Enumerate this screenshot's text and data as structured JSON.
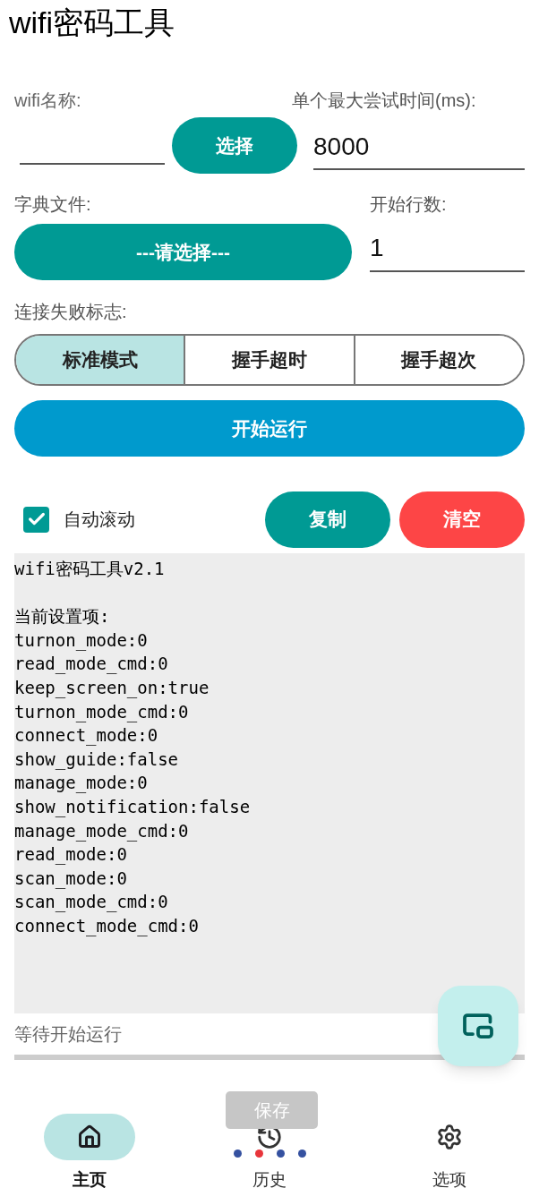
{
  "title": "wifi密码工具",
  "wifi_name": {
    "label": "wifi名称:",
    "button": "选择"
  },
  "max_time": {
    "label": "单个最大尝试时间(ms):",
    "value": "8000"
  },
  "dict_file": {
    "label": "字典文件:",
    "button": "---请选择---"
  },
  "start_line": {
    "label": "开始行数:",
    "value": "1"
  },
  "fail_flag": {
    "label": "连接失败标志:",
    "options": [
      {
        "label": "标准模式",
        "selected": true
      },
      {
        "label": "握手超时",
        "selected": false
      },
      {
        "label": "握手超次",
        "selected": false
      }
    ]
  },
  "run_button": "开始运行",
  "auto_scroll": {
    "label": "自动滚动",
    "checked": true
  },
  "copy_button": "复制",
  "clear_button": "清空",
  "log": [
    {
      "lines": [
        "wifi密码工具v2.1"
      ]
    },
    {
      "lines": [
        "当前设置项:",
        "turnon_mode:0",
        "read_mode_cmd:0",
        "keep_screen_on:true",
        "turnon_mode_cmd:0",
        "connect_mode:0",
        "show_guide:false",
        "manage_mode:0",
        "show_notification:false",
        "manage_mode_cmd:0",
        "read_mode:0",
        "scan_mode:0",
        "scan_mode_cmd:0",
        "connect_mode_cmd:0"
      ]
    }
  ],
  "status": "等待开始运行",
  "save_button": "保存",
  "page_dots": [
    {
      "selected": false
    },
    {
      "selected": true
    },
    {
      "selected": false
    },
    {
      "selected": false
    }
  ],
  "nav": [
    {
      "kind": "home",
      "label": "主页",
      "selected": true
    },
    {
      "kind": "history",
      "label": "历史",
      "selected": false
    },
    {
      "kind": "settings",
      "label": "选项",
      "selected": false
    }
  ]
}
